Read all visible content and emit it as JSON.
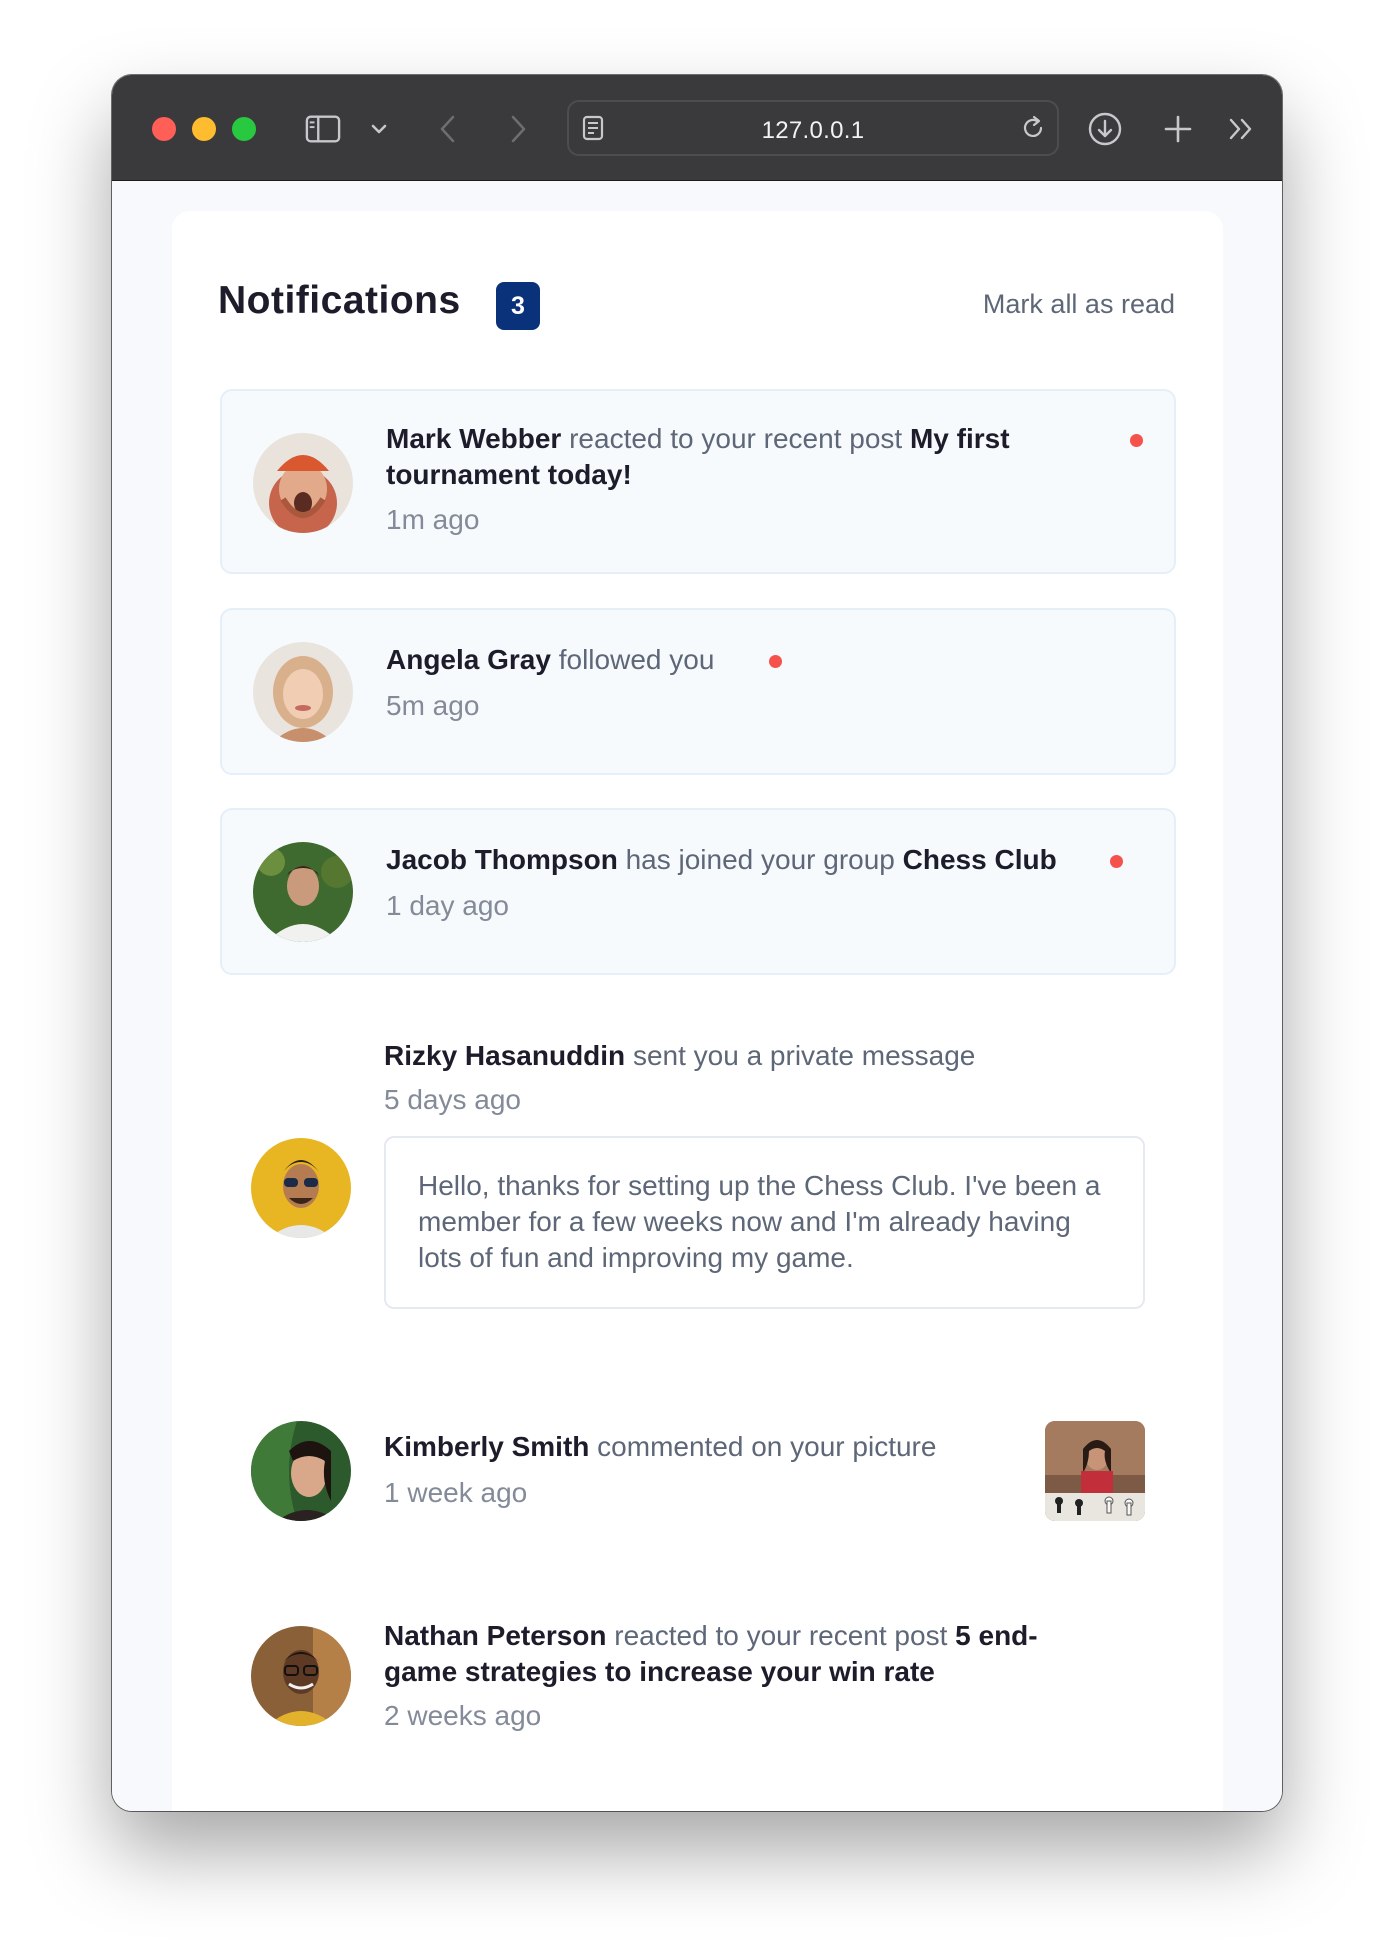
{
  "browser": {
    "url": "127.0.0.1",
    "icons": [
      "sidebar-icon",
      "chevron-down-icon",
      "back-icon",
      "forward-icon",
      "reader-icon",
      "reload-icon",
      "download-icon",
      "new-tab-icon",
      "more-icon"
    ]
  },
  "header": {
    "title": "Notifications",
    "count": "3",
    "mark_all": "Mark all as read"
  },
  "notifications": [
    {
      "name": "Mark Webber",
      "action": " reacted to your recent post ",
      "object": "My first tournament today!",
      "time": "1m ago",
      "unread": true
    },
    {
      "name": "Angela Gray",
      "action": " followed you",
      "time": "5m ago",
      "unread": true
    },
    {
      "name": "Jacob Thompson",
      "action": " has joined your group ",
      "object": "Chess Club",
      "time": "1 day ago",
      "unread": true
    },
    {
      "name": "Rizky Hasanuddin",
      "action": " sent you a private message",
      "time": "5 days ago",
      "message": "Hello, thanks for setting up the Chess Club. I've been a member for a few weeks now and I'm already having lots of fun and improving my game.",
      "unread": false
    },
    {
      "name": "Kimberly Smith",
      "action": " commented on your picture",
      "time": "1 week ago",
      "unread": false
    },
    {
      "name": "Nathan Peterson",
      "action": " reacted to your recent post ",
      "object": "5 end-game strategies to increase your win rate",
      "time": "2 weeks ago",
      "unread": false
    }
  ],
  "colors": {
    "accent": "#0a327b",
    "unread_dot": "#f4524b",
    "unread_bg": "#f7fafd"
  }
}
